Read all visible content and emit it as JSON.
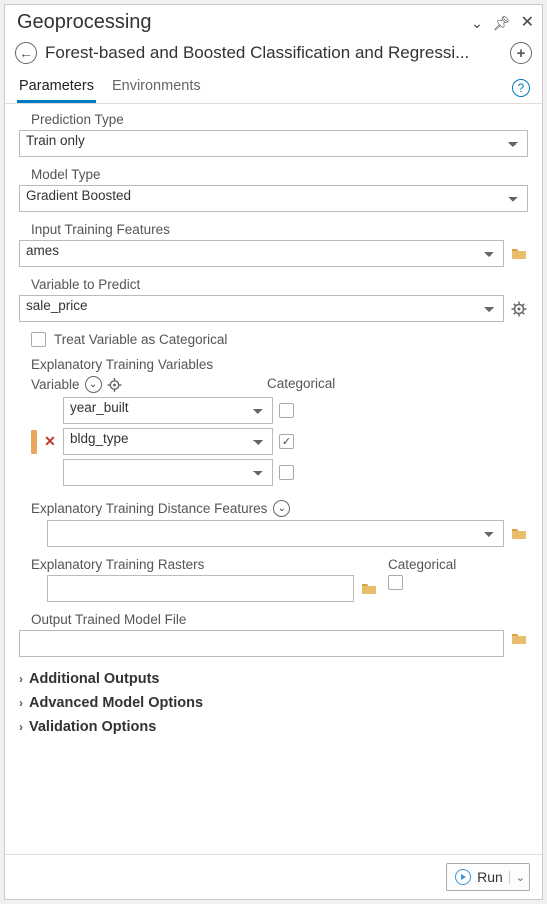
{
  "titlebar": {
    "title": "Geoprocessing"
  },
  "tool": {
    "name": "Forest-based and Boosted Classification and Regressi..."
  },
  "tabs": {
    "parameters": "Parameters",
    "environments": "Environments"
  },
  "fields": {
    "prediction_type": {
      "label": "Prediction Type",
      "value": "Train only"
    },
    "model_type": {
      "label": "Model Type",
      "value": "Gradient Boosted"
    },
    "input_training_features": {
      "label": "Input Training Features",
      "value": "ames"
    },
    "variable_to_predict": {
      "label": "Variable to Predict",
      "value": "sale_price"
    },
    "treat_categorical": {
      "label": "Treat Variable as Categorical",
      "checked": false
    },
    "etv": {
      "section_label": "Explanatory Training Variables",
      "variable_header": "Variable",
      "categorical_header": "Categorical",
      "rows": [
        {
          "value": "year_built",
          "categorical": false,
          "removable": false
        },
        {
          "value": "bldg_type",
          "categorical": true,
          "removable": true
        },
        {
          "value": "",
          "categorical": false,
          "removable": false
        }
      ]
    },
    "etdf": {
      "label": "Explanatory Training Distance Features",
      "value": ""
    },
    "etr": {
      "label": "Explanatory Training Rasters",
      "categorical_label": "Categorical",
      "value": "",
      "categorical": false
    },
    "output_model": {
      "label": "Output Trained Model File",
      "value": ""
    }
  },
  "expanders": {
    "additional_outputs": "Additional Outputs",
    "advanced_model_options": "Advanced Model Options",
    "validation_options": "Validation Options"
  },
  "footer": {
    "run": "Run"
  }
}
